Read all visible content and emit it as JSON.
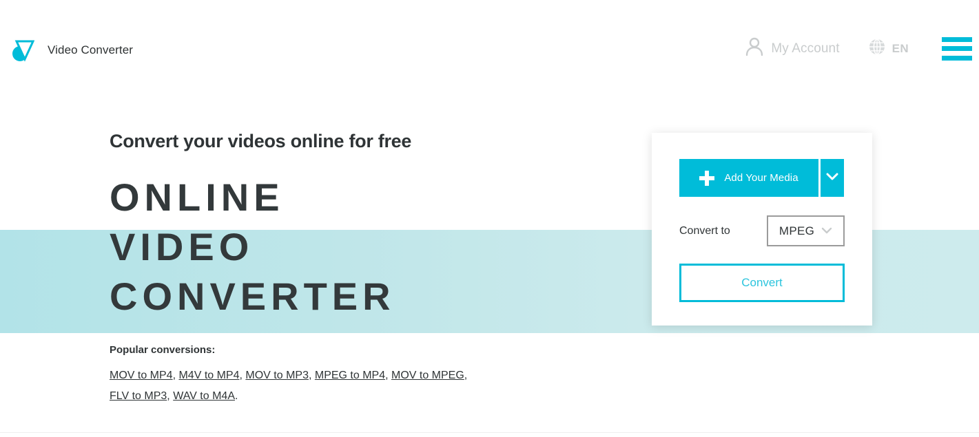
{
  "header": {
    "brand_name": "Video Converter",
    "logo_icon": "triangle-circle-logo",
    "account_label": "My Account",
    "account_icon": "person-icon",
    "language_label": "EN",
    "language_icon": "globe-icon",
    "menu_icon": "hamburger-menu-icon"
  },
  "hero": {
    "kicker": "Convert your videos online for free",
    "title_line1": "ONLINE",
    "title_line2": "VIDEO",
    "title_line3": "CONVERTER"
  },
  "popular": {
    "heading": "Popular conversions:",
    "links": [
      "MOV to MP4",
      "M4V to MP4",
      "MOV to MP3",
      "MPEG to MP4",
      "MOV to MPEG",
      "FLV to MP3",
      "WAV to M4A"
    ],
    "separator": ", ",
    "terminator": "."
  },
  "card": {
    "add_media_label": "Add Your Media",
    "add_media_plus_icon": "plus-icon",
    "add_media_caret_icon": "chevron-down-icon",
    "convert_to_label": "Convert to",
    "format_value": "MPEG",
    "format_caret_icon": "chevron-down-icon",
    "convert_button_label": "Convert"
  },
  "colors": {
    "accent": "#00bcd9",
    "accent_text": "#2bc4dd",
    "band_start": "#b2e3e8",
    "band_end": "#cdebed",
    "text_dark": "#2f3436",
    "muted": "#c9cccd",
    "select_border": "#9b9b9b"
  }
}
